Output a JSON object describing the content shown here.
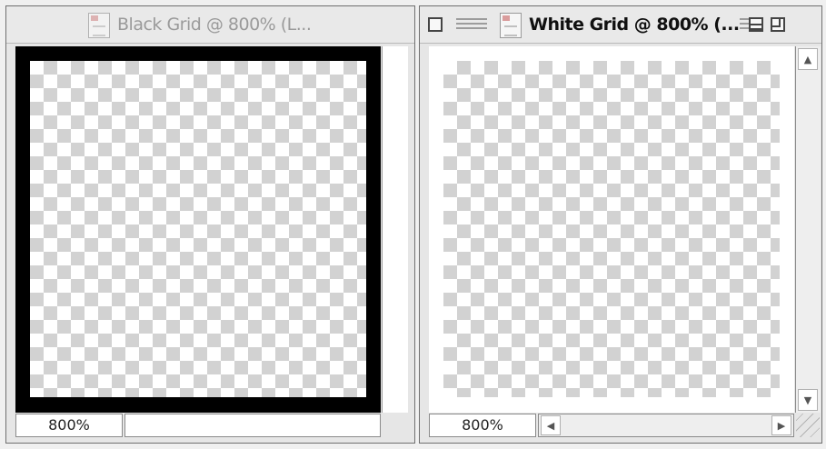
{
  "windows": {
    "left": {
      "title": "Black Grid @ 800% (L...",
      "zoom": "800%",
      "active": false,
      "border_color": "#000000"
    },
    "right": {
      "title": "White Grid @ 800% (...",
      "zoom": "800%",
      "active": true,
      "border_color": "#ffffff"
    }
  },
  "icons": {
    "document": "document-icon",
    "close": "close-box-icon",
    "collapse": "collapse-box-icon",
    "zoom": "zoom-box-icon",
    "scroll_up": "▲",
    "scroll_down": "▼",
    "scroll_left": "◀",
    "scroll_right": "▶",
    "grow": "resize-grip-icon"
  },
  "colors": {
    "checker_light": "#ffffff",
    "checker_dark": "#d2d2d2",
    "chrome": "#e6e6e6"
  }
}
